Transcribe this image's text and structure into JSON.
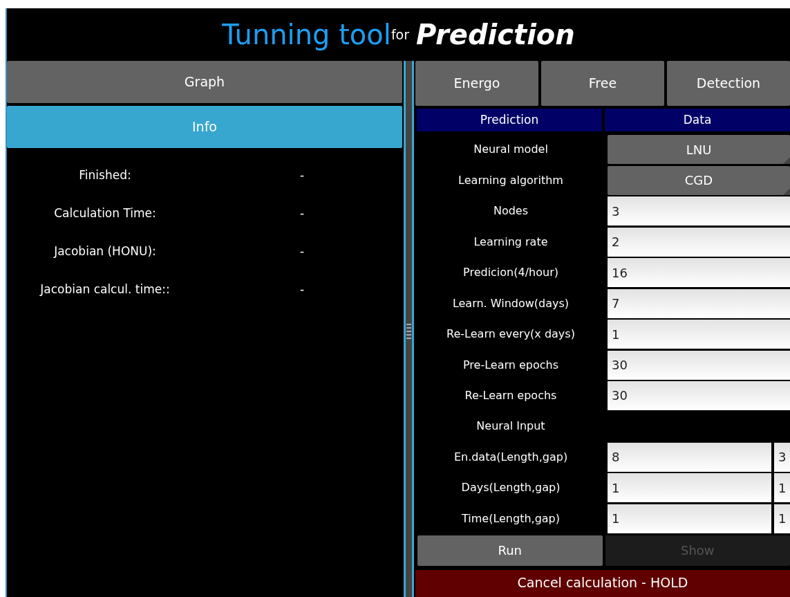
{
  "title": {
    "main": "Tunning tool",
    "connector": "for",
    "subject": "Prediction"
  },
  "left_tabs": [
    {
      "label": "Graph",
      "selected": false
    },
    {
      "label": "Info",
      "selected": true
    }
  ],
  "info": [
    {
      "label": "Finished:",
      "value": "-"
    },
    {
      "label": "Calculation Time:",
      "value": "-"
    },
    {
      "label": "Jacobian (HONU):",
      "value": "-"
    },
    {
      "label": "Jacobian calcul. time::",
      "value": "-"
    }
  ],
  "right_tabs": [
    {
      "label": "Energo",
      "selected": false
    },
    {
      "label": "Free",
      "selected": false
    },
    {
      "label": "Detection",
      "selected": false
    }
  ],
  "sub_headers": [
    "Prediction",
    "Data"
  ],
  "form": [
    {
      "kind": "dropdown",
      "label": "Neural model",
      "value": "LNU"
    },
    {
      "kind": "dropdown",
      "label": "Learning algorithm",
      "value": "CGD"
    },
    {
      "kind": "input",
      "label": "Nodes",
      "value": "3"
    },
    {
      "kind": "input",
      "label": "Learning rate",
      "value": "2"
    },
    {
      "kind": "input",
      "label": "Predicion(4/hour)",
      "value": "16"
    },
    {
      "kind": "input",
      "label": "Learn. Window(days)",
      "value": "7"
    },
    {
      "kind": "input",
      "label": "Re-Learn every(x days)",
      "value": "1"
    },
    {
      "kind": "input",
      "label": "Pre-Learn epochs",
      "value": "30"
    },
    {
      "kind": "input",
      "label": "Re-Learn epochs",
      "value": "30"
    },
    {
      "kind": "heading",
      "label": "Neural Input"
    },
    {
      "kind": "pair",
      "label": "En.data(Length,gap)",
      "values": [
        "8",
        "3"
      ]
    },
    {
      "kind": "pair",
      "label": "Days(Length,gap)",
      "values": [
        "1",
        "1"
      ]
    },
    {
      "kind": "pair",
      "label": "Time(Length,gap)",
      "values": [
        "1",
        "1"
      ]
    }
  ],
  "actions": [
    {
      "label": "Run",
      "disabled": false
    },
    {
      "label": "Show",
      "disabled": true
    }
  ],
  "cancel_bar": "Cancel calculation - HOLD"
}
